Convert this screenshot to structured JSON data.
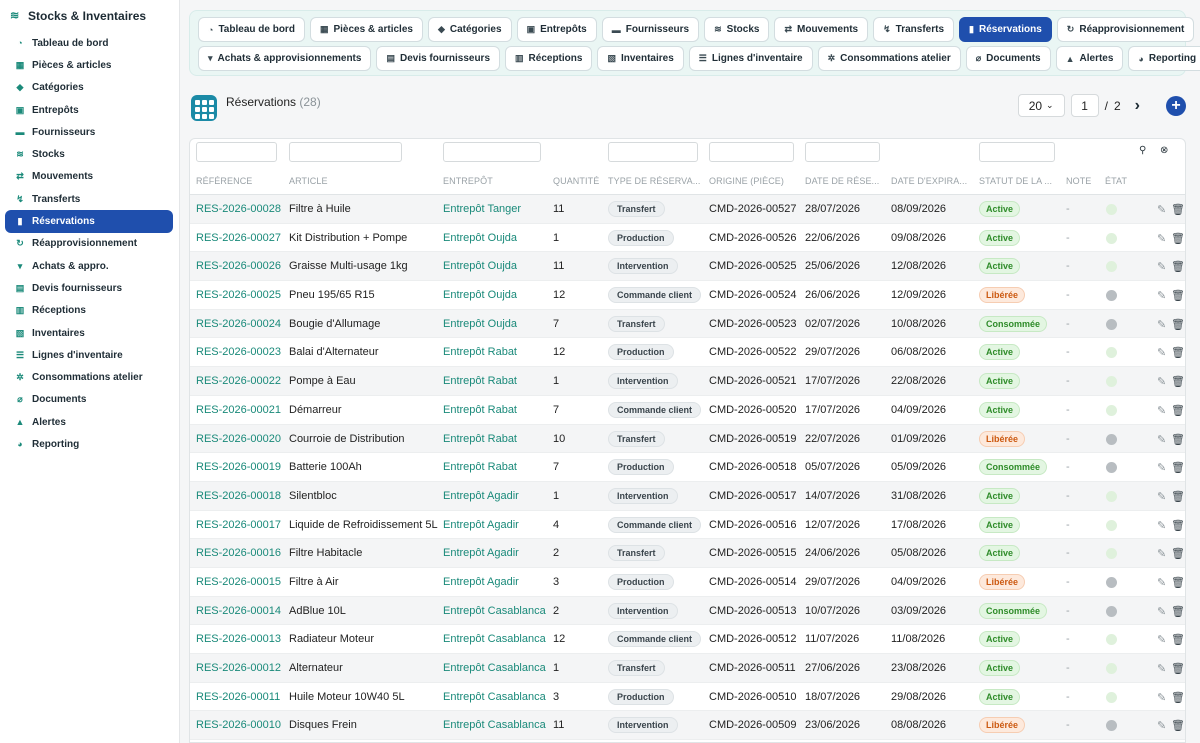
{
  "app": {
    "title": "Stocks & Inventaires"
  },
  "sidebar": {
    "items": [
      {
        "label": "Tableau de bord",
        "icon": "dashboard-icon",
        "glyph": "◔",
        "active": false
      },
      {
        "label": "Pièces & articles",
        "icon": "parts-icon",
        "glyph": "▦",
        "active": false
      },
      {
        "label": "Catégories",
        "icon": "tag-icon",
        "glyph": "◆",
        "active": false
      },
      {
        "label": "Entrepôts",
        "icon": "warehouse-icon",
        "glyph": "▣",
        "active": false
      },
      {
        "label": "Fournisseurs",
        "icon": "truck-icon",
        "glyph": "▬",
        "active": false
      },
      {
        "label": "Stocks",
        "icon": "layers-icon",
        "glyph": "≋",
        "active": false
      },
      {
        "label": "Mouvements",
        "icon": "exchange-icon",
        "glyph": "⇄",
        "active": false
      },
      {
        "label": "Transferts",
        "icon": "dolly-icon",
        "glyph": "↯",
        "active": false
      },
      {
        "label": "Réservations",
        "icon": "bookmark-icon",
        "glyph": "▮",
        "active": true
      },
      {
        "label": "Réapprovisionnement",
        "icon": "sync-icon",
        "glyph": "↻",
        "active": false
      },
      {
        "label": "Achats & appro.",
        "icon": "cart-icon",
        "glyph": "▾",
        "active": false
      },
      {
        "label": "Devis fournisseurs",
        "icon": "file-icon",
        "glyph": "▤",
        "active": false
      },
      {
        "label": "Réceptions",
        "icon": "receive-icon",
        "glyph": "▥",
        "active": false
      },
      {
        "label": "Inventaires",
        "icon": "clipboard-icon",
        "glyph": "▧",
        "active": false
      },
      {
        "label": "Lignes d'inventaire",
        "icon": "list-icon",
        "glyph": "☰",
        "active": false
      },
      {
        "label": "Consommations atelier",
        "icon": "cogs-icon",
        "glyph": "✲",
        "active": false
      },
      {
        "label": "Documents",
        "icon": "paperclip-icon",
        "glyph": "⌀",
        "active": false
      },
      {
        "label": "Alertes",
        "icon": "bell-icon",
        "glyph": "▲",
        "active": false
      },
      {
        "label": "Reporting",
        "icon": "pie-chart-icon",
        "glyph": "◕",
        "active": false
      }
    ]
  },
  "topnav": {
    "row1": [
      {
        "label": "Tableau de bord",
        "icon": "dashboard-icon",
        "glyph": "◔",
        "active": false
      },
      {
        "label": "Pièces & articles",
        "icon": "parts-icon",
        "glyph": "▦",
        "active": false
      },
      {
        "label": "Catégories",
        "icon": "tag-icon",
        "glyph": "◆",
        "active": false
      },
      {
        "label": "Entrepôts",
        "icon": "warehouse-icon",
        "glyph": "▣",
        "active": false
      },
      {
        "label": "Fournisseurs",
        "icon": "truck-icon",
        "glyph": "▬",
        "active": false
      },
      {
        "label": "Stocks",
        "icon": "layers-icon",
        "glyph": "≋",
        "active": false
      },
      {
        "label": "Mouvements",
        "icon": "exchange-icon",
        "glyph": "⇄",
        "active": false
      },
      {
        "label": "Transferts",
        "icon": "dolly-icon",
        "glyph": "↯",
        "active": false
      },
      {
        "label": "Réservations",
        "icon": "bookmark-icon",
        "glyph": "▮",
        "active": true
      },
      {
        "label": "Réapprovisionnement",
        "icon": "sync-icon",
        "glyph": "↻",
        "active": false
      }
    ],
    "row2": [
      {
        "label": "Achats & approvisionnements",
        "icon": "cart-icon",
        "glyph": "▾",
        "active": false
      },
      {
        "label": "Devis fournisseurs",
        "icon": "file-icon",
        "glyph": "▤",
        "active": false
      },
      {
        "label": "Réceptions",
        "icon": "receive-icon",
        "glyph": "▥",
        "active": false
      },
      {
        "label": "Inventaires",
        "icon": "clipboard-icon",
        "glyph": "▧",
        "active": false
      },
      {
        "label": "Lignes d'inventaire",
        "icon": "list-icon",
        "glyph": "☰",
        "active": false
      },
      {
        "label": "Consommations atelier",
        "icon": "cogs-icon",
        "glyph": "✲",
        "active": false
      },
      {
        "label": "Documents",
        "icon": "paperclip-icon",
        "glyph": "⌀",
        "active": false
      },
      {
        "label": "Alertes",
        "icon": "bell-icon",
        "glyph": "▲",
        "active": false
      },
      {
        "label": "Reporting",
        "icon": "pie-chart-icon",
        "glyph": "◕",
        "active": false
      }
    ]
  },
  "page": {
    "title": "Réservations",
    "count": "(28)",
    "per_page": "20",
    "current_page": "1",
    "separator": "/",
    "total_pages": "2"
  },
  "table": {
    "headers": [
      "RÉFÉRENCE",
      "ARTICLE",
      "ENTREPÔT",
      "QUANTITÉ",
      "TYPE DE RÉSERVA...",
      "ORIGINE (PIÈCE)",
      "DATE DE RÉSE...",
      "DATE D'EXPIRA...",
      "STATUT DE LA ...",
      "NOTE",
      "ÉTAT"
    ],
    "rows": [
      {
        "ref": "RES-2026-00028",
        "article": "Filtre à Huile",
        "entrepot": "Entrepôt Tanger",
        "qty": "11",
        "type": "Transfert",
        "origine": "CMD-2026-00527",
        "date_res": "28/07/2026",
        "date_exp": "08/09/2026",
        "statut": "Active",
        "statut_kind": "active",
        "note": "-",
        "etat": "on"
      },
      {
        "ref": "RES-2026-00027",
        "article": "Kit Distribution + Pompe",
        "entrepot": "Entrepôt Oujda",
        "qty": "1",
        "type": "Production",
        "origine": "CMD-2026-00526",
        "date_res": "22/06/2026",
        "date_exp": "09/08/2026",
        "statut": "Active",
        "statut_kind": "active",
        "note": "-",
        "etat": "on"
      },
      {
        "ref": "RES-2026-00026",
        "article": "Graisse Multi-usage 1kg",
        "entrepot": "Entrepôt Oujda",
        "qty": "11",
        "type": "Intervention",
        "origine": "CMD-2026-00525",
        "date_res": "25/06/2026",
        "date_exp": "12/08/2026",
        "statut": "Active",
        "statut_kind": "active",
        "note": "-",
        "etat": "on"
      },
      {
        "ref": "RES-2026-00025",
        "article": "Pneu 195/65 R15",
        "entrepot": "Entrepôt Oujda",
        "qty": "12",
        "type": "Commande client",
        "origine": "CMD-2026-00524",
        "date_res": "26/06/2026",
        "date_exp": "12/09/2026",
        "statut": "Libérée",
        "statut_kind": "freed",
        "note": "-",
        "etat": "off"
      },
      {
        "ref": "RES-2026-00024",
        "article": "Bougie d'Allumage",
        "entrepot": "Entrepôt Oujda",
        "qty": "7",
        "type": "Transfert",
        "origine": "CMD-2026-00523",
        "date_res": "02/07/2026",
        "date_exp": "10/08/2026",
        "statut": "Consommée",
        "statut_kind": "used",
        "note": "-",
        "etat": "off"
      },
      {
        "ref": "RES-2026-00023",
        "article": "Balai d'Alternateur",
        "entrepot": "Entrepôt Rabat",
        "qty": "12",
        "type": "Production",
        "origine": "CMD-2026-00522",
        "date_res": "29/07/2026",
        "date_exp": "06/08/2026",
        "statut": "Active",
        "statut_kind": "active",
        "note": "-",
        "etat": "on"
      },
      {
        "ref": "RES-2026-00022",
        "article": "Pompe à Eau",
        "entrepot": "Entrepôt Rabat",
        "qty": "1",
        "type": "Intervention",
        "origine": "CMD-2026-00521",
        "date_res": "17/07/2026",
        "date_exp": "22/08/2026",
        "statut": "Active",
        "statut_kind": "active",
        "note": "-",
        "etat": "on"
      },
      {
        "ref": "RES-2026-00021",
        "article": "Démarreur",
        "entrepot": "Entrepôt Rabat",
        "qty": "7",
        "type": "Commande client",
        "origine": "CMD-2026-00520",
        "date_res": "17/07/2026",
        "date_exp": "04/09/2026",
        "statut": "Active",
        "statut_kind": "active",
        "note": "-",
        "etat": "on"
      },
      {
        "ref": "RES-2026-00020",
        "article": "Courroie de Distribution",
        "entrepot": "Entrepôt Rabat",
        "qty": "10",
        "type": "Transfert",
        "origine": "CMD-2026-00519",
        "date_res": "22/07/2026",
        "date_exp": "01/09/2026",
        "statut": "Libérée",
        "statut_kind": "freed",
        "note": "-",
        "etat": "off"
      },
      {
        "ref": "RES-2026-00019",
        "article": "Batterie 100Ah",
        "entrepot": "Entrepôt Rabat",
        "qty": "7",
        "type": "Production",
        "origine": "CMD-2026-00518",
        "date_res": "05/07/2026",
        "date_exp": "05/09/2026",
        "statut": "Consommée",
        "statut_kind": "used",
        "note": "-",
        "etat": "off"
      },
      {
        "ref": "RES-2026-00018",
        "article": "Silentbloc",
        "entrepot": "Entrepôt Agadir",
        "qty": "1",
        "type": "Intervention",
        "origine": "CMD-2026-00517",
        "date_res": "14/07/2026",
        "date_exp": "31/08/2026",
        "statut": "Active",
        "statut_kind": "active",
        "note": "-",
        "etat": "on"
      },
      {
        "ref": "RES-2026-00017",
        "article": "Liquide de Refroidissement 5L",
        "entrepot": "Entrepôt Agadir",
        "qty": "4",
        "type": "Commande client",
        "origine": "CMD-2026-00516",
        "date_res": "12/07/2026",
        "date_exp": "17/08/2026",
        "statut": "Active",
        "statut_kind": "active",
        "note": "-",
        "etat": "on"
      },
      {
        "ref": "RES-2026-00016",
        "article": "Filtre Habitacle",
        "entrepot": "Entrepôt Agadir",
        "qty": "2",
        "type": "Transfert",
        "origine": "CMD-2026-00515",
        "date_res": "24/06/2026",
        "date_exp": "05/08/2026",
        "statut": "Active",
        "statut_kind": "active",
        "note": "-",
        "etat": "on"
      },
      {
        "ref": "RES-2026-00015",
        "article": "Filtre à Air",
        "entrepot": "Entrepôt Agadir",
        "qty": "3",
        "type": "Production",
        "origine": "CMD-2026-00514",
        "date_res": "29/07/2026",
        "date_exp": "04/09/2026",
        "statut": "Libérée",
        "statut_kind": "freed",
        "note": "-",
        "etat": "off"
      },
      {
        "ref": "RES-2026-00014",
        "article": "AdBlue 10L",
        "entrepot": "Entrepôt Casablanca",
        "qty": "2",
        "type": "Intervention",
        "origine": "CMD-2026-00513",
        "date_res": "10/07/2026",
        "date_exp": "03/09/2026",
        "statut": "Consommée",
        "statut_kind": "used",
        "note": "-",
        "etat": "off"
      },
      {
        "ref": "RES-2026-00013",
        "article": "Radiateur Moteur",
        "entrepot": "Entrepôt Casablanca",
        "qty": "12",
        "type": "Commande client",
        "origine": "CMD-2026-00512",
        "date_res": "11/07/2026",
        "date_exp": "11/08/2026",
        "statut": "Active",
        "statut_kind": "active",
        "note": "-",
        "etat": "on"
      },
      {
        "ref": "RES-2026-00012",
        "article": "Alternateur",
        "entrepot": "Entrepôt Casablanca",
        "qty": "1",
        "type": "Transfert",
        "origine": "CMD-2026-00511",
        "date_res": "27/06/2026",
        "date_exp": "23/08/2026",
        "statut": "Active",
        "statut_kind": "active",
        "note": "-",
        "etat": "on"
      },
      {
        "ref": "RES-2026-00011",
        "article": "Huile Moteur 10W40 5L",
        "entrepot": "Entrepôt Casablanca",
        "qty": "3",
        "type": "Production",
        "origine": "CMD-2026-00510",
        "date_res": "18/07/2026",
        "date_exp": "29/08/2026",
        "statut": "Active",
        "statut_kind": "active",
        "note": "-",
        "etat": "on"
      },
      {
        "ref": "RES-2026-00010",
        "article": "Disques Frein",
        "entrepot": "Entrepôt Casablanca",
        "qty": "11",
        "type": "Intervention",
        "origine": "CMD-2026-00509",
        "date_res": "23/06/2026",
        "date_exp": "08/08/2026",
        "statut": "Libérée",
        "statut_kind": "freed",
        "note": "-",
        "etat": "off"
      }
    ]
  },
  "colors": {
    "accent": "#1f4fad",
    "link": "#1a8a7a",
    "active_status": "#2f8c2a",
    "freed_status": "#cc5a12"
  }
}
